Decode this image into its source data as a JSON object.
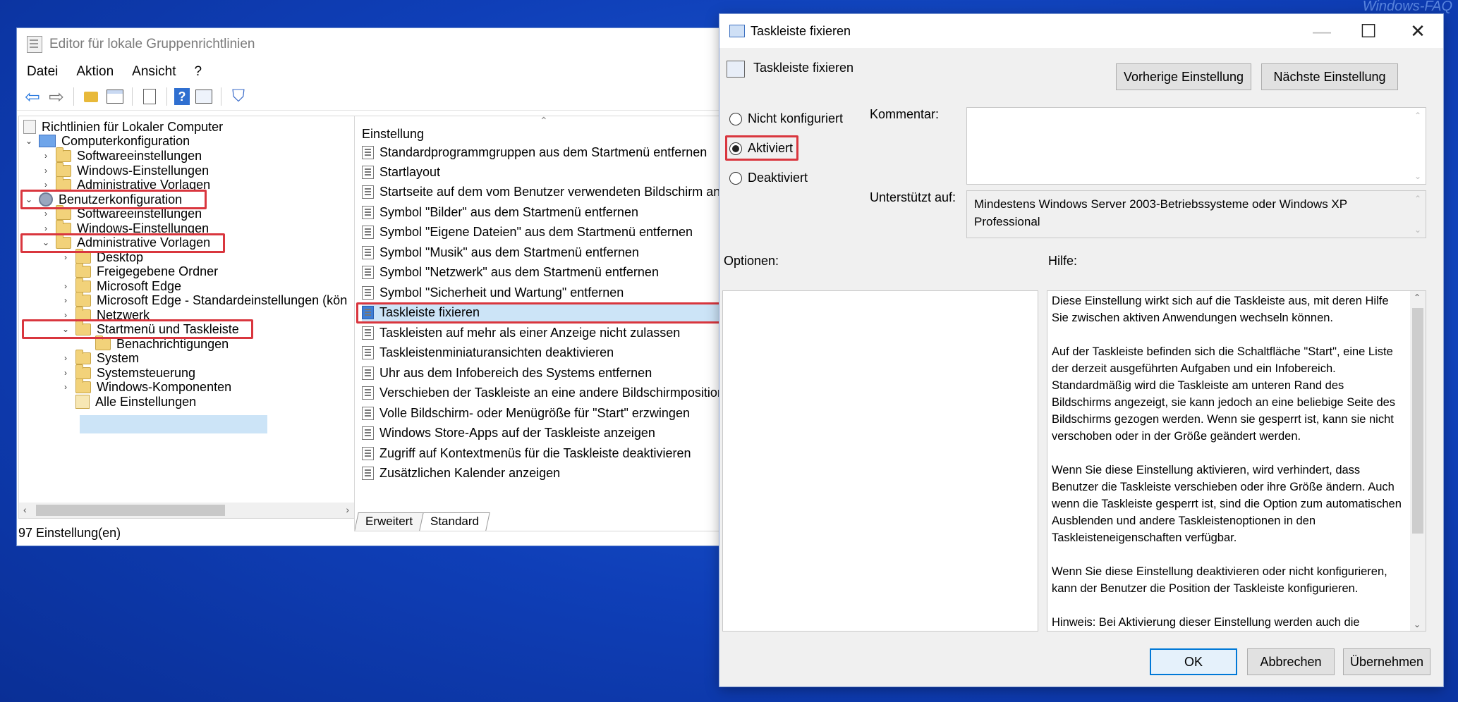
{
  "watermark": "Windows-FAQ",
  "editor": {
    "title": "Editor für lokale Gruppenrichtlinien",
    "menu": [
      "Datei",
      "Aktion",
      "Ansicht",
      "?"
    ],
    "toolbar_icons": [
      "back-arrow-icon",
      "forward-arrow-icon",
      "folder-up-icon",
      "grid-view-icon",
      "export-list-icon",
      "help-icon",
      "properties-icon",
      "filter-icon"
    ],
    "tree": {
      "root": "Richtlinien für Lokaler Computer",
      "computer": "Computerkonfiguration",
      "c_software": "Softwareeinstellungen",
      "c_windows": "Windows-Einstellungen",
      "c_admin": "Administrative Vorlagen",
      "user": "Benutzerkonfiguration",
      "u_software": "Softwareeinstellungen",
      "u_windows": "Windows-Einstellungen",
      "u_admin": "Administrative Vorlagen",
      "desktop": "Desktop",
      "shared": "Freigegebene Ordner",
      "edge": "Microsoft Edge",
      "edge_default": "Microsoft Edge - Standardeinstellungen (kön",
      "network": "Netzwerk",
      "startmenu": "Startmenü und Taskleiste",
      "notifications": "Benachrichtigungen",
      "system": "System",
      "control": "Systemsteuerung",
      "components": "Windows-Komponenten",
      "all": "Alle Einstellungen"
    },
    "list_header": "Einstellung",
    "list_items": [
      "Standardprogrammgruppen aus dem Startmenü entfernen",
      "Startlayout",
      "Startseite auf dem vom Benutzer verwendeten Bildschirm anz...",
      "Symbol \"Bilder\" aus dem Startmenü entfernen",
      "Symbol \"Eigene Dateien\" aus dem Startmenü entfernen",
      "Symbol \"Musik\" aus dem Startmenü entfernen",
      "Symbol \"Netzwerk\" aus dem Startmenü entfernen",
      "Symbol \"Sicherheit und Wartung\" entfernen",
      "Taskleiste fixieren",
      "Taskleisten auf mehr als einer Anzeige nicht zulassen",
      "Taskleistenminiaturansichten deaktivieren",
      "Uhr aus dem Infobereich des Systems entfernen",
      "Verschieben der Taskleiste an eine andere Bildschirmposition ...",
      "Volle Bildschirm- oder Menügröße für \"Start\" erzwingen",
      "Windows Store-Apps auf der Taskleiste anzeigen",
      "Zugriff auf Kontextmenüs für die Taskleiste deaktivieren",
      "Zusätzlichen Kalender anzeigen"
    ],
    "tabs": [
      "Erweitert",
      "Standard"
    ],
    "status": "97 Einstellung(en)"
  },
  "dialog": {
    "title": "Taskleiste fixieren",
    "header_label": "Taskleiste fixieren",
    "prev_button": "Vorherige Einstellung",
    "next_button": "Nächste Einstellung",
    "radio_not_configured": "Nicht konfiguriert",
    "radio_enabled": "Aktiviert",
    "radio_disabled": "Deaktiviert",
    "comment_label": "Kommentar:",
    "comment_value": "",
    "supported_label": "Unterstützt auf:",
    "supported_value": "Mindestens Windows Server 2003-Betriebssysteme oder Windows XP Professional",
    "options_label": "Optionen:",
    "help_label": "Hilfe:",
    "help_paragraphs": [
      "Diese Einstellung wirkt sich auf die Taskleiste aus, mit deren Hilfe Sie zwischen aktiven Anwendungen wechseln können.",
      "Auf der Taskleiste befinden sich die Schaltfläche \"Start\", eine Liste der derzeit ausgeführten Aufgaben und ein Infobereich. Standardmäßig wird die Taskleiste am unteren Rand des Bildschirms angezeigt, sie kann jedoch an eine beliebige Seite des Bildschirms gezogen werden. Wenn sie gesperrt ist, kann sie nicht verschoben oder in der Größe geändert werden.",
      "Wenn Sie diese Einstellung aktivieren, wird verhindert, dass Benutzer die Taskleiste verschieben oder ihre Größe ändern. Auch wenn die Taskleiste gesperrt ist, sind die Option zum automatischen Ausblenden und andere Taskleistenoptionen in den Taskleisteneigenschaften verfügbar.",
      "Wenn Sie diese Einstellung deaktivieren oder nicht konfigurieren, kann der Benutzer die Position der Taskleiste konfigurieren.",
      "Hinweis: Bei Aktivierung dieser Einstellung werden auch die"
    ],
    "ok": "OK",
    "cancel": "Abbrechen",
    "apply": "Übernehmen",
    "selected_radio": "Aktiviert"
  },
  "colors": {
    "highlight": "#d9363e",
    "selection": "#cce4f7",
    "desktop": "#1349c4"
  }
}
